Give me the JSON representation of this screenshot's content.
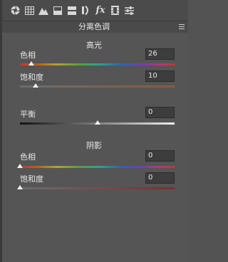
{
  "panel": {
    "title": "分离色调"
  },
  "toolbar": {
    "icons": [
      "aperture-icon",
      "grid-icon",
      "mountains-icon",
      "split-icon",
      "stack-icon",
      "lens-icon",
      "fx-icon",
      "film-icon",
      "sliders-icon"
    ],
    "fx_label": "fx"
  },
  "highlights": {
    "title": "高光",
    "hue_label": "色相",
    "hue_value": "26",
    "saturation_label": "饱和度",
    "saturation_value": "10"
  },
  "balance": {
    "label": "平衡",
    "value": "0"
  },
  "shadows": {
    "title": "阴影",
    "hue_label": "色相",
    "hue_value": "0",
    "saturation_label": "饱和度",
    "saturation_value": "0"
  },
  "slider_levels": {
    "highlights_hue": 26,
    "highlights_saturation": 10,
    "balance": 0,
    "shadows_hue": 0,
    "shadows_saturation": 0
  }
}
